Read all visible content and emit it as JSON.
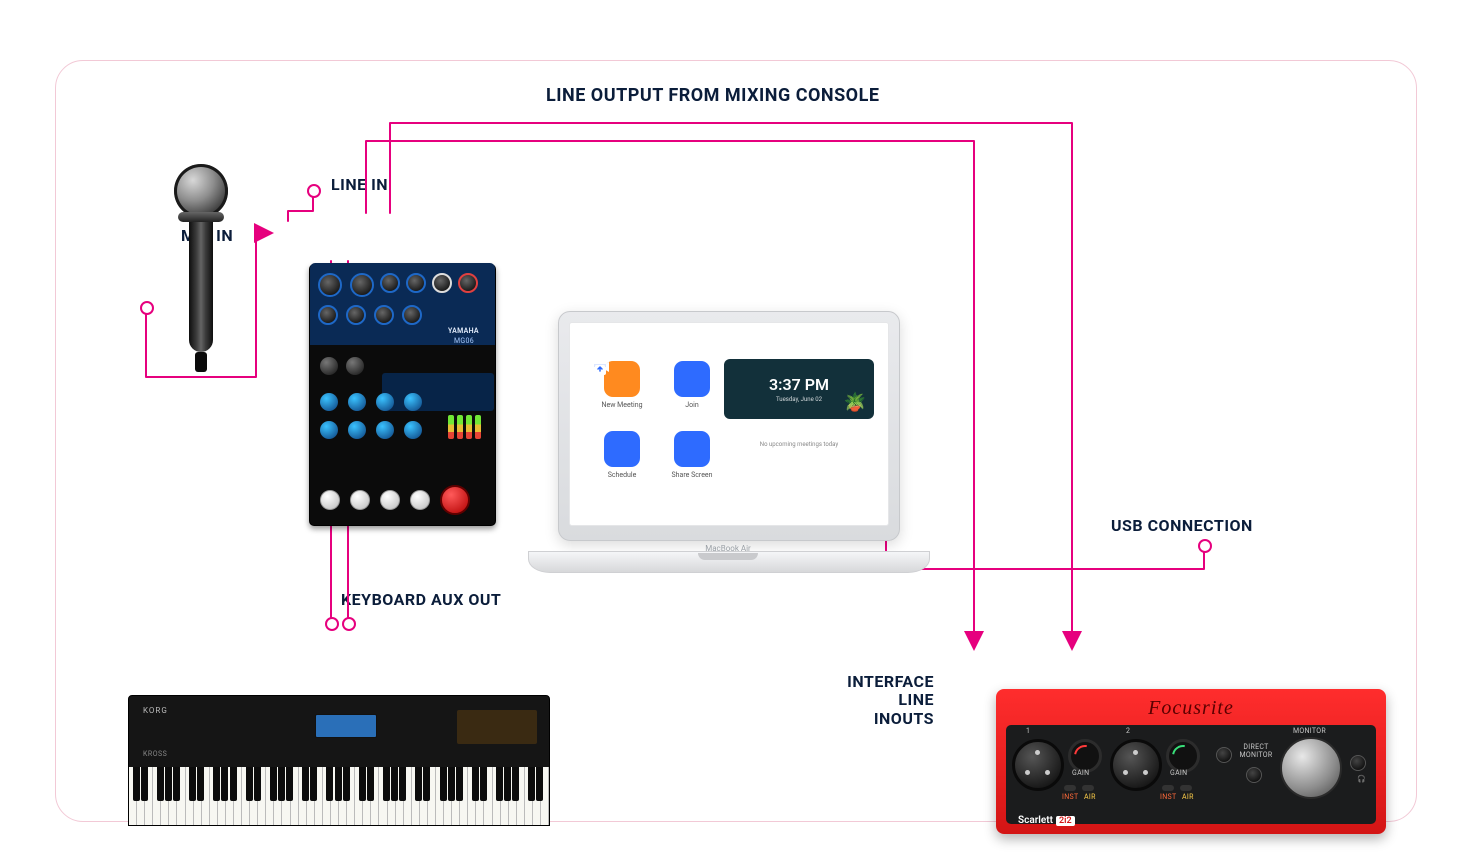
{
  "labels": {
    "line_output": "LINE OUTPUT FROM MIXING CONSOLE",
    "line_in": "LINE IN",
    "mic_in": "MIC IN",
    "keyboard_aux_out": "KEYBOARD AUX OUT",
    "usb_connection": "USB CONNECTION",
    "interface_line_inouts": "INTERFACE\nLINE\nINOUTS"
  },
  "laptop": {
    "time": "3:37 PM",
    "date": "Tuesday, June 02",
    "brand": "MacBook Air",
    "no_meetings": "No upcoming meetings today",
    "buttons": {
      "new_meeting": "New Meeting",
      "join": "Join",
      "schedule": "Schedule",
      "share_screen": "Share Screen"
    }
  },
  "mixer": {
    "brand": "YAMAHA",
    "model": "MG06"
  },
  "interface": {
    "brand": "Focusrite",
    "model_a": "Scarlett",
    "model_b": "2i2",
    "labels": {
      "gain": "GAIN",
      "inst": "INST",
      "air": "AIR",
      "direct_monitor": "DIRECT\nMONITOR",
      "monitor": "MONITOR",
      "ch1": "1",
      "ch2": "2"
    }
  },
  "keyboard": {
    "brand": "KORG",
    "model": "KROSS"
  },
  "colors": {
    "accent": "#e6007e",
    "label": "#0b1d3a",
    "interface_red": "#e61e1e"
  }
}
